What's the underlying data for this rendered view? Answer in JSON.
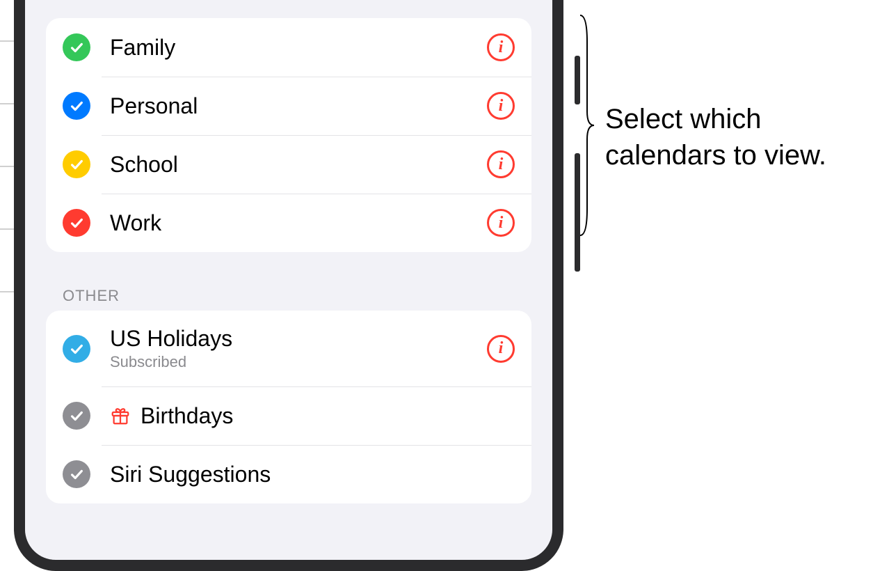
{
  "callout_text": "Select which calendars to view.",
  "sections": {
    "main": {
      "items": [
        {
          "label": "Family",
          "color": "#34c759",
          "checked": true,
          "has_info": true
        },
        {
          "label": "Personal",
          "color": "#007aff",
          "checked": true,
          "has_info": true
        },
        {
          "label": "School",
          "color": "#ffcc00",
          "checked": true,
          "has_info": true
        },
        {
          "label": "Work",
          "color": "#ff3b30",
          "checked": true,
          "has_info": true
        }
      ]
    },
    "other": {
      "header": "OTHER",
      "items": [
        {
          "label": "US Holidays",
          "subtitle": "Subscribed",
          "color": "#32ade6",
          "checked": true,
          "has_info": true
        },
        {
          "label": "Birthdays",
          "icon": "gift",
          "color": "#8e8e93",
          "checked": true,
          "has_info": false
        },
        {
          "label": "Siri Suggestions",
          "color": "#8e8e93",
          "checked": true,
          "has_info": false
        }
      ]
    }
  }
}
